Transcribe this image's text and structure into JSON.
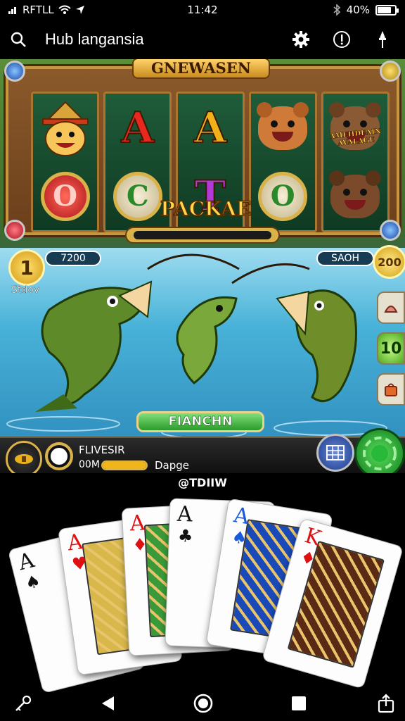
{
  "status_bar": {
    "carrier": "RFTLL",
    "time": "11:42",
    "battery_text": "40%",
    "battery_level": 0.8
  },
  "app_bar": {
    "title": "Hub langansia",
    "icons": [
      "search-icon",
      "settings-icon",
      "info-icon",
      "pin-icon"
    ]
  },
  "game": {
    "banner_title": "GNEWASEN",
    "reels": [
      {
        "top": "hat-face-symbol",
        "bottom": "O"
      },
      {
        "top": "A",
        "bottom": "C"
      },
      {
        "top": "A",
        "bottom": "T"
      },
      {
        "top": "bear-symbol",
        "bottom": "O"
      },
      {
        "top": "bear-symbol",
        "bottom": "bear-symbol"
      }
    ],
    "bear_caption": "AMEHDEAIN AVALAGE",
    "package_label": "PACKAE",
    "left_badge_value": "1",
    "left_pill_value": "7200",
    "left_label": "Stdov",
    "right_pill_value": "SAOH",
    "right_coin_value": "200",
    "side_green_value": "10",
    "play_button": "FIANCHN",
    "hud": {
      "line1": "FLIVESIR",
      "line2_prefix": "00M",
      "line2_suffix": "Dapge",
      "bar_level": 1.0
    },
    "colors": {
      "frame_gold": "#c8963c",
      "go_green": "#1fa62c",
      "water": "#48b2d8"
    }
  },
  "watermark": "@TDIIW",
  "cards": [
    {
      "rank": "A",
      "suit": "♠",
      "color": "#111"
    },
    {
      "rank": "A",
      "suit": "♥",
      "color": "#d11"
    },
    {
      "rank": "A",
      "suit": "♦",
      "color": "#d11"
    },
    {
      "rank": "A",
      "suit": "♣",
      "color": "#111"
    },
    {
      "rank": "A",
      "suit": "♠",
      "color": "#1a5ad8"
    },
    {
      "rank": "K",
      "suit": "♦",
      "color": "#d11"
    }
  ],
  "nav_bar": {
    "icons": [
      "key-icon",
      "back-icon",
      "home-icon",
      "recents-icon",
      "share-icon"
    ]
  }
}
